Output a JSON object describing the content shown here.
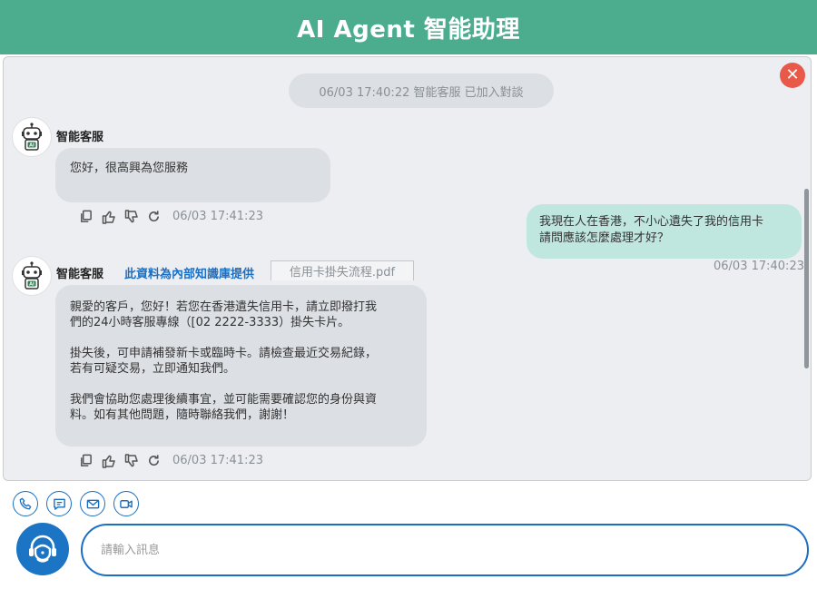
{
  "header": {
    "title": "AI Agent 智能助理"
  },
  "chat": {
    "system_message": "06/03 17:40:22 智能客服 已加入對談",
    "messages": [
      {
        "sender": "智能客服",
        "text": "您好，很高興為您服務",
        "timestamp": "06/03 17:41:23"
      },
      {
        "sender": "user",
        "text": "我現在人在香港，不小心遺失了我的信用卡\n請問應該怎麼處理才好？",
        "timestamp": "06/03 17:40:23"
      },
      {
        "sender": "智能客服",
        "source_label": "此資料為內部知識庫提供",
        "source_file": "信用卡掛失流程.pdf",
        "paragraphs": [
          "親愛的客戶，您好！若您在香港遺失信用卡，請立即撥打我\n們的24小時客服專線（[02 2222-3333）掛失卡片。",
          "掛失後，可申請補發新卡或臨時卡。請檢查最近交易紀錄，\n若有可疑交易，立即通知我們。",
          "我們會協助您處理後續事宜，並可能需要確認您的身份與資\n料。如有其他問題，隨時聯絡我們，謝謝！"
        ],
        "timestamp": "06/03 17:41:23"
      }
    ]
  },
  "input": {
    "placeholder": "請輸入訊息",
    "value": ""
  },
  "icons": {
    "close": "close-icon",
    "copy": "copy-icon",
    "like": "thumbs-up-icon",
    "dislike": "thumbs-down-icon",
    "regenerate": "refresh-icon",
    "channels": [
      "phone-icon",
      "chat-icon",
      "mail-icon",
      "video-icon"
    ],
    "agent": "headset-agent-icon",
    "bot": "robot-icon"
  },
  "colors": {
    "header": "#4cad8e",
    "accent": "#1b6fc2",
    "user_bubble": "#bfe6df",
    "bot_bubble": "#dcdfe3",
    "close": "#e8594a"
  }
}
